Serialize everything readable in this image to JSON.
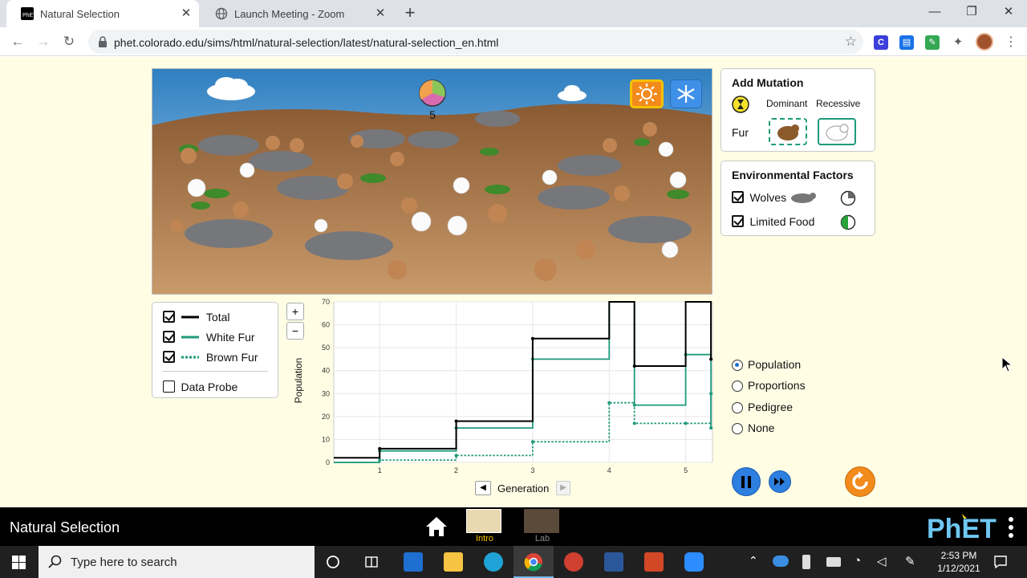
{
  "browser": {
    "tabs": [
      {
        "title": "Natural Selection",
        "active": true
      },
      {
        "title": "Launch Meeting - Zoom",
        "active": false
      }
    ],
    "url": "phet.colorado.edu/sims/html/natural-selection/latest/natural-selection_en.html"
  },
  "scene": {
    "generation_count": "5",
    "environment_buttons": [
      "sun-icon",
      "snowflake-icon"
    ]
  },
  "add_mutation": {
    "title": "Add Mutation",
    "dominant_label": "Dominant",
    "recessive_label": "Recessive",
    "fur_label": "Fur"
  },
  "environmental_factors": {
    "title": "Environmental Factors",
    "items": [
      {
        "label": "Wolves",
        "checked": true
      },
      {
        "label": "Limited Food",
        "checked": true
      }
    ]
  },
  "legend": {
    "items": [
      {
        "label": "Total",
        "checked": true,
        "color": "#000000"
      },
      {
        "label": "White Fur",
        "checked": true,
        "color": "#1e9a7a"
      },
      {
        "label": "Brown Fur",
        "checked": true,
        "color": "#1e9a7a"
      }
    ],
    "data_probe_label": "Data Probe",
    "data_probe_checked": false
  },
  "zoom": {
    "plus": "+",
    "minus": "−"
  },
  "graph_view": {
    "options": [
      {
        "label": "Population",
        "selected": true
      },
      {
        "label": "Proportions",
        "selected": false
      },
      {
        "label": "Pedigree",
        "selected": false
      },
      {
        "label": "None",
        "selected": false
      }
    ]
  },
  "chart_data": {
    "type": "line",
    "xlabel": "Generation",
    "ylabel": "Population",
    "xlim": [
      0.4,
      5.35
    ],
    "ylim": [
      0,
      70
    ],
    "x_ticks": [
      1,
      2,
      3,
      4,
      5
    ],
    "y_ticks": [
      0,
      10,
      20,
      30,
      40,
      50,
      60,
      70
    ],
    "grid": true,
    "series": [
      {
        "name": "Total",
        "style": "solid",
        "color": "#000000",
        "points": [
          [
            0.4,
            2
          ],
          [
            1,
            2
          ],
          [
            1,
            6
          ],
          [
            2,
            6
          ],
          [
            2,
            18
          ],
          [
            3,
            18
          ],
          [
            3,
            54
          ],
          [
            4,
            54
          ],
          [
            4,
            70
          ],
          [
            4.33,
            70
          ],
          [
            4.33,
            42
          ],
          [
            5,
            42
          ],
          [
            5,
            70
          ],
          [
            5.33,
            70
          ],
          [
            5.33,
            45
          ]
        ]
      },
      {
        "name": "White Fur",
        "style": "solid",
        "color": "#1e9a7a",
        "points": [
          [
            0.4,
            0
          ],
          [
            1,
            0
          ],
          [
            1,
            5
          ],
          [
            2,
            5
          ],
          [
            2,
            15
          ],
          [
            3,
            15
          ],
          [
            3,
            45
          ],
          [
            4,
            45
          ],
          [
            4,
            70
          ],
          [
            4.33,
            70
          ],
          [
            4.33,
            25
          ],
          [
            5,
            25
          ],
          [
            5,
            47
          ],
          [
            5.33,
            47
          ],
          [
            5.33,
            15
          ]
        ]
      },
      {
        "name": "Brown Fur",
        "style": "dotted",
        "color": "#1e9a7a",
        "points": [
          [
            0.4,
            0
          ],
          [
            1,
            0
          ],
          [
            1,
            1
          ],
          [
            2,
            1
          ],
          [
            2,
            3
          ],
          [
            3,
            3
          ],
          [
            3,
            9
          ],
          [
            4,
            9
          ],
          [
            4,
            26
          ],
          [
            4.33,
            26
          ],
          [
            4.33,
            17
          ],
          [
            5,
            17
          ],
          [
            5,
            17
          ],
          [
            5.33,
            17
          ],
          [
            5.33,
            30
          ]
        ]
      }
    ]
  },
  "phet_nav": {
    "sim_title": "Natural Selection",
    "screens": [
      {
        "label": "Intro",
        "selected": true
      },
      {
        "label": "Lab",
        "selected": false
      }
    ]
  },
  "taskbar": {
    "search_placeholder": "Type here to search",
    "time": "2:53 PM",
    "date": "1/12/2021"
  }
}
